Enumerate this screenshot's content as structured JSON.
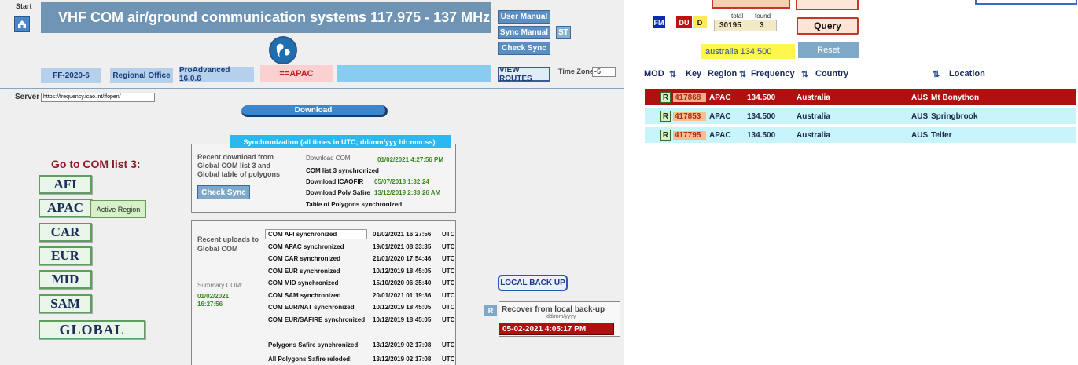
{
  "left": {
    "start_label": "Start",
    "title": "VHF COM air/ground communication systems 117.975 - 137 MHz",
    "buttons": {
      "user_manual": "User Manual",
      "sync_manual": "Sync Manual",
      "st": "ST",
      "check_sync": "Check Sync",
      "view_routes": "VIEW ROUTES",
      "download": "Download",
      "check_sync_panel": "Check Sync",
      "local_backup": "LOCAL BACK UP",
      "r": "R"
    },
    "tags": {
      "ff": "FF-2020-6",
      "regional": "Regional Office",
      "pro": "ProAdvanced 16.0.6",
      "apac": "==APAC"
    },
    "timezone_label": "Time Zone",
    "timezone_value": "-5",
    "server_label": "Server",
    "server_value": "https://frequency.icao.int/ffopen/",
    "goto_label": "Go to COM list 3:",
    "nav": [
      "AFI",
      "APAC",
      "CAR",
      "EUR",
      "MID",
      "SAM",
      "GLOBAL"
    ],
    "active_region": "Active Region",
    "sync_header": "Synchronization (all times in UTC; dd/mm/yyy hh:mm:ss):",
    "recent_download": "Recent download from Global COM list 3 and Global table of polygons",
    "download_com": "Download COM",
    "download_com_date": "01/02/2021 4:27:56 PM",
    "com_list_synced": "COM list 3 synchronized",
    "download_icaofir": "Download ICAOFIR",
    "download_icaofir_date": "05/07/2018 1:32:24",
    "download_poly": "Download Poly Safire",
    "download_poly_date": "13/12/2019 2:33:26 AM",
    "table_poly": "Table of Polygons synchronized",
    "recent_uploads": "Recent uploads to Global COM",
    "summary_com": "Summary COM:",
    "summary_date": "01/02/2021 16:27:56",
    "uploads": [
      {
        "name": "COM AFI synchronized",
        "date": "01/02/2021 16:27:56",
        "tz": "UTC"
      },
      {
        "name": "COM APAC synchronized",
        "date": "19/01/2021 08:33:35",
        "tz": "UTC"
      },
      {
        "name": "COM CAR synchronized",
        "date": "21/01/2020 17:54:46",
        "tz": "UTC"
      },
      {
        "name": "COM EUR synchronized",
        "date": "10/12/2019 18:45:05",
        "tz": "UTC"
      },
      {
        "name": "COM MID synchronized",
        "date": "15/10/2020 06:35:40",
        "tz": "UTC"
      },
      {
        "name": "COM SAM synchronized",
        "date": "20/01/2021 01:19:36",
        "tz": "UTC"
      },
      {
        "name": "COM EUR/NAT synchronized",
        "date": "10/12/2019 18:45:05",
        "tz": "UTC"
      },
      {
        "name": "COM EUR/SAFIRE synchronized",
        "date": "10/12/2019 18:45:05",
        "tz": "UTC"
      }
    ],
    "poly_rows": [
      {
        "name": "Polygons Safire synchronized",
        "date": "13/12/2019 02:17:08",
        "tz": "UTC"
      },
      {
        "name": "All Polygons Safire reloded:",
        "date": "13/12/2019 02:17:08",
        "tz": "UTC"
      }
    ],
    "recover_label": "Recover from local back-up",
    "recover_format": "dd/mm/yyyy",
    "recover_value": "05-02-2021 4:05:17 PM"
  },
  "right": {
    "fm": "FM",
    "du": "DU",
    "d": "D",
    "total_label": "total",
    "found_label": "found",
    "total_value": "30195",
    "found_value": "3",
    "query": "Query",
    "search_value": "australia 134.500",
    "reset": "Reset",
    "headers": {
      "mod": "MOD",
      "key": "Key",
      "region": "Region",
      "frequency": "Frequency",
      "country": "Country",
      "location": "Location"
    },
    "rows": [
      {
        "r": "R",
        "key": "417868",
        "region": "APAC",
        "freq": "134.500",
        "country": "Australia",
        "code": "AUS",
        "location": "Mt Bonython"
      },
      {
        "r": "R",
        "key": "417853",
        "region": "APAC",
        "freq": "134.500",
        "country": "Australia",
        "code": "AUS",
        "location": "Springbrook"
      },
      {
        "r": "R",
        "key": "417795",
        "region": "APAC",
        "freq": "134.500",
        "country": "Australia",
        "code": "AUS",
        "location": "Telfer"
      }
    ]
  }
}
